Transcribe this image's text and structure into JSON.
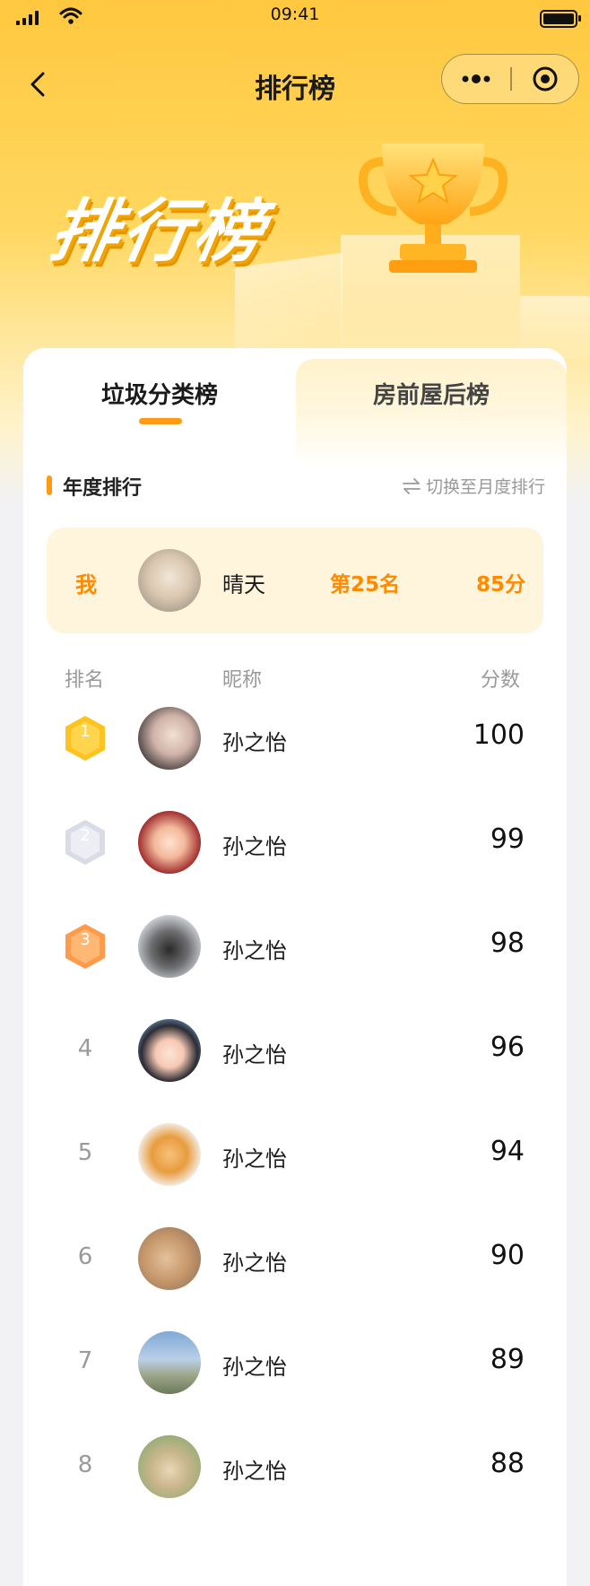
{
  "status_bar": {
    "time": "09:41"
  },
  "nav": {
    "title": "排行榜"
  },
  "banner": {
    "title": "排行榜"
  },
  "tabs": [
    {
      "label": "垃圾分类榜",
      "active": true
    },
    {
      "label": "房前屋后榜",
      "active": false
    }
  ],
  "section": {
    "title": "年度排行",
    "switch_label": "切换至月度排行"
  },
  "me": {
    "label": "我",
    "name": "晴天",
    "rank": "第25名",
    "score": "85分"
  },
  "table": {
    "headers": {
      "rank": "排名",
      "name": "昵称",
      "score": "分数"
    },
    "rows": [
      {
        "rank": "1",
        "name": "孙之怡",
        "score": "100"
      },
      {
        "rank": "2",
        "name": "孙之怡",
        "score": "99"
      },
      {
        "rank": "3",
        "name": "孙之怡",
        "score": "98"
      },
      {
        "rank": "4",
        "name": "孙之怡",
        "score": "96"
      },
      {
        "rank": "5",
        "name": "孙之怡",
        "score": "94"
      },
      {
        "rank": "6",
        "name": "孙之怡",
        "score": "90"
      },
      {
        "rank": "7",
        "name": "孙之怡",
        "score": "89"
      },
      {
        "rank": "8",
        "name": "孙之怡",
        "score": "88"
      }
    ]
  },
  "colors": {
    "accent": "#ff9a14",
    "accent_text": "#ff8a00",
    "gold": "#ffc31f",
    "silver": "#d9dce4",
    "bronze": "#ff9a4a"
  }
}
